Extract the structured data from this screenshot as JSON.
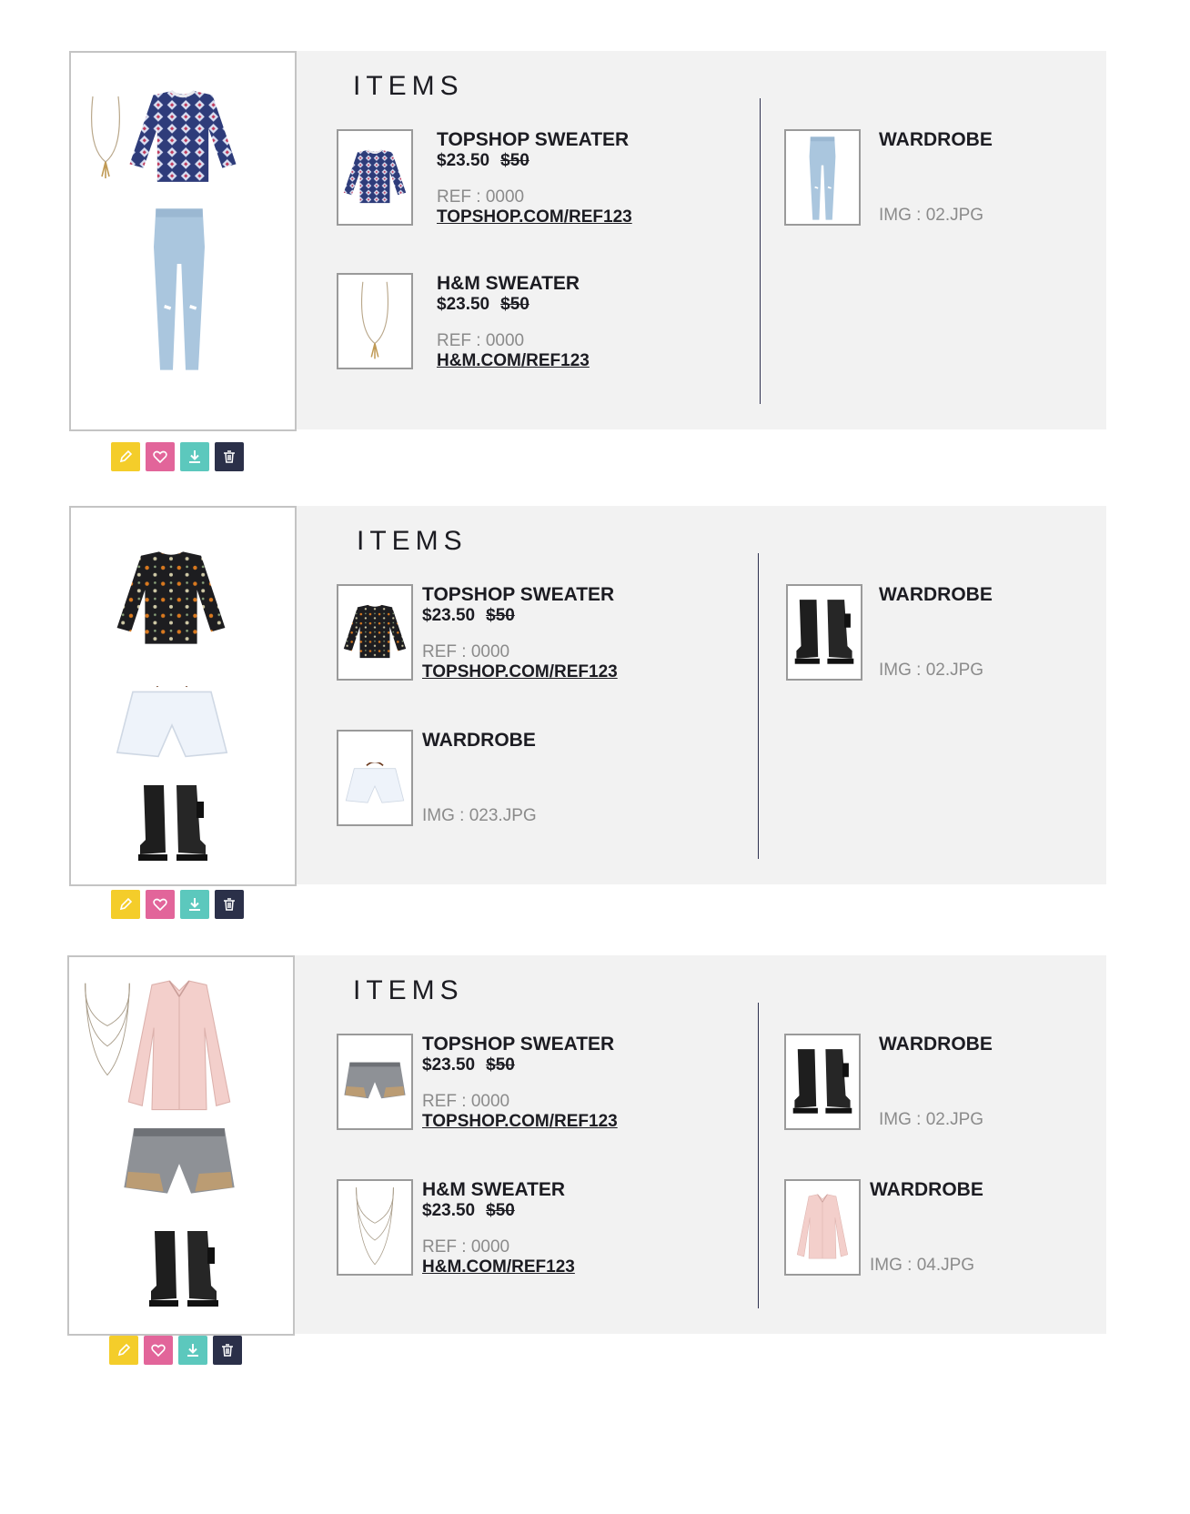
{
  "colors": {
    "panel_bg": "#f2f2f2",
    "divider": "#2f3150",
    "edit_button": "#f4cd2a",
    "favorite_button": "#e2659a",
    "download_button": "#5cc8bd",
    "delete_button": "#2b3049",
    "muted_text": "#8b8b8b"
  },
  "action_icons": [
    "pencil-icon",
    "heart-icon",
    "download-icon",
    "trash-icon"
  ],
  "outfits": [
    {
      "heading": "ITEMS",
      "left_items": [
        {
          "title": "TOPSHOP SWEATER",
          "price": "$23.50",
          "old_price": "$50",
          "ref": "REF : 0000",
          "link": "TOPSHOP.COM/REF123"
        },
        {
          "title": "H&M SWEATER",
          "price": "$23.50",
          "old_price": "$50",
          "ref": "REF : 0000",
          "link": "H&M.COM/REF123"
        }
      ],
      "right_items": [
        {
          "title": "WARDROBE",
          "img": "IMG : 02.JPG"
        }
      ]
    },
    {
      "heading": "ITEMS",
      "left_items": [
        {
          "title": "TOPSHOP SWEATER",
          "price": "$23.50",
          "old_price": "$50",
          "ref": "REF : 0000",
          "link": "TOPSHOP.COM/REF123"
        },
        {
          "title": "WARDROBE",
          "img": "IMG : 023.JPG"
        }
      ],
      "right_items": [
        {
          "title": "WARDROBE",
          "img": "IMG : 02.JPG"
        }
      ]
    },
    {
      "heading": "ITEMS",
      "left_items": [
        {
          "title": "TOPSHOP SWEATER",
          "price": "$23.50",
          "old_price": "$50",
          "ref": "REF : 0000",
          "link": "TOPSHOP.COM/REF123"
        },
        {
          "title": "H&M SWEATER",
          "price": "$23.50",
          "old_price": "$50",
          "ref": "REF : 0000",
          "link": "H&M.COM/REF123"
        }
      ],
      "right_items": [
        {
          "title": "WARDROBE",
          "img": "IMG : 02.JPG"
        },
        {
          "title": "WARDROBE",
          "img": "IMG : 04.JPG"
        }
      ]
    }
  ]
}
